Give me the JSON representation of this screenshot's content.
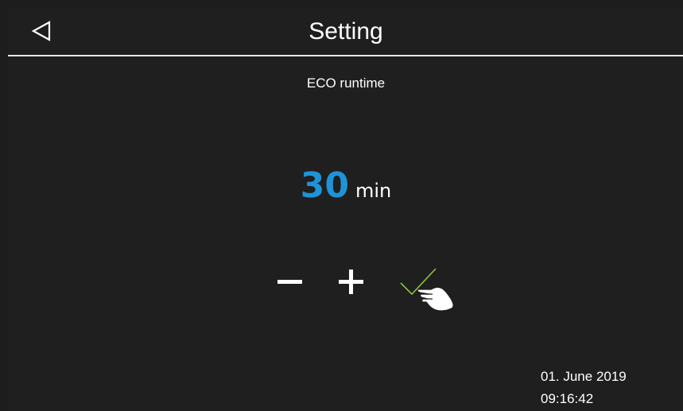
{
  "header": {
    "back_icon": "back-triangle-icon",
    "title": "Setting"
  },
  "main": {
    "setting_label": "ECO runtime",
    "value": "30",
    "unit": "min",
    "decrease_icon": "minus-icon",
    "increase_icon": "plus-icon",
    "confirm_icon": "checkmark-icon",
    "cursor_icon": "hand-pointer-icon"
  },
  "status": {
    "date": "01. June 2019",
    "time": "09:16:42"
  },
  "colors": {
    "background": "#1f1f1f",
    "value_accent": "#1e93d8",
    "confirm_accent": "#8cc63f"
  }
}
